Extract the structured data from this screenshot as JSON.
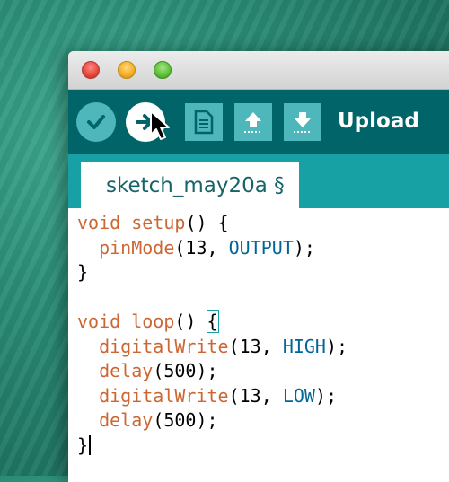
{
  "window": {
    "traffic_lights": [
      "close",
      "minimize",
      "maximize"
    ]
  },
  "toolbar": {
    "verify_icon": "checkmark-icon",
    "upload_icon": "arrow-right-icon",
    "new_icon": "document-icon",
    "open_icon": "arrow-up-icon",
    "save_icon": "arrow-down-icon",
    "hover_label": "Upload",
    "colors": {
      "bar": "#006468",
      "button": "#4db7bb",
      "active_button": "#ffffff"
    }
  },
  "tabs": [
    {
      "label": "sketch_may20a §",
      "active": true
    }
  ],
  "editor": {
    "lines": [
      [
        {
          "t": "void",
          "c": "kw"
        },
        {
          "t": " "
        },
        {
          "t": "setup",
          "c": "fn"
        },
        {
          "t": "() {"
        }
      ],
      [
        {
          "t": "  "
        },
        {
          "t": "pinMode",
          "c": "fn"
        },
        {
          "t": "(13, "
        },
        {
          "t": "OUTPUT",
          "c": "const"
        },
        {
          "t": ");"
        }
      ],
      [
        {
          "t": "}"
        }
      ],
      [],
      [
        {
          "t": "void",
          "c": "kw"
        },
        {
          "t": " "
        },
        {
          "t": "loop",
          "c": "fn"
        },
        {
          "t": "() "
        },
        {
          "t": "{",
          "c": "brace-box"
        }
      ],
      [
        {
          "t": "  "
        },
        {
          "t": "digitalWrite",
          "c": "fn"
        },
        {
          "t": "(13, "
        },
        {
          "t": "HIGH",
          "c": "const"
        },
        {
          "t": ");"
        }
      ],
      [
        {
          "t": "  "
        },
        {
          "t": "delay",
          "c": "fn"
        },
        {
          "t": "(500);"
        }
      ],
      [
        {
          "t": "  "
        },
        {
          "t": "digitalWrite",
          "c": "fn"
        },
        {
          "t": "(13, "
        },
        {
          "t": "LOW",
          "c": "const"
        },
        {
          "t": ");"
        }
      ],
      [
        {
          "t": "  "
        },
        {
          "t": "delay",
          "c": "fn"
        },
        {
          "t": "(500);"
        }
      ],
      [
        {
          "t": "}"
        },
        {
          "caret": true
        }
      ]
    ],
    "colors": {
      "keyword": "#cc6633",
      "constant": "#006699",
      "match_brace": "#17a1a5"
    }
  }
}
